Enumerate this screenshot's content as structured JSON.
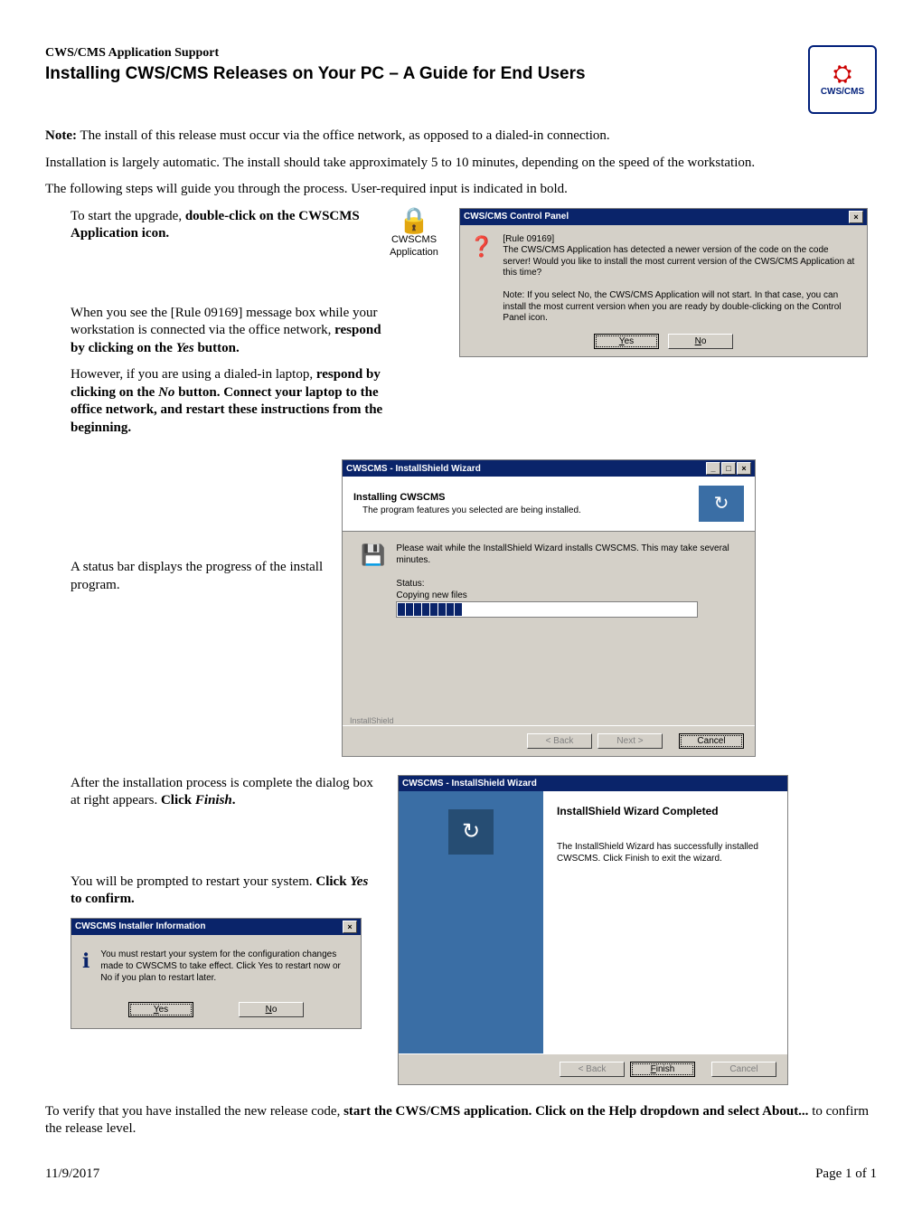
{
  "header": {
    "sup": "CWS/CMS Application Support",
    "title": "Installing CWS/CMS Releases on Your PC – A Guide for End Users",
    "logo_text": "CWS/CMS"
  },
  "intro": {
    "note_label": "Note:",
    "note_text": "  The install of this release must occur via the office network, as opposed to a dialed-in connection.",
    "p2": "Installation is largely automatic.  The install should take approximately 5 to 10 minutes, depending on the speed of the workstation.",
    "p3": "The following steps will guide you through the process.  User-required input is indicated in bold."
  },
  "step1": {
    "a": "To start the upgrade, ",
    "b": "double-click on the CWSCMS Application icon.",
    "icon_label": "CWSCMS Application"
  },
  "step2": {
    "a": "When you see the [Rule 09169] message box while your workstation is connected via the office network, ",
    "b": "respond by clicking on the ",
    "c": "Yes",
    "d": " button."
  },
  "step3": {
    "a": "However, if you are using a dialed-in laptop, ",
    "b": "respond by clicking on the ",
    "c": "No",
    "d": " button.  Connect your laptop to the office network, and restart these instructions from the beginning."
  },
  "cp": {
    "title": "CWS/CMS Control Panel",
    "rule": "[Rule 09169]",
    "msg": "The CWS/CMS Application has detected a newer version of the code on the code server!  Would you like to install the most current version of the CWS/CMS Application at this time?",
    "note": "Note: If you select No, the CWS/CMS Application will not start. In that case, you can install the most current version when you are ready by double-clicking on the Control Panel icon.",
    "yes": "Yes",
    "no": "No"
  },
  "step4": {
    "text": "A status bar displays the progress of the install program."
  },
  "is": {
    "title": "CWSCMS - InstallShield Wizard",
    "h1": "Installing CWSCMS",
    "h2": "The program features you selected are being installed.",
    "body": "Please wait while the InstallShield Wizard installs CWSCMS. This may take several minutes.",
    "status_label": "Status:",
    "status_value": "Copying new files",
    "footline": "InstallShield",
    "back": "< Back",
    "next": "Next >",
    "cancel": "Cancel"
  },
  "step5": {
    "a": "After the installation process is complete the dialog box at right appears. ",
    "b": "Click ",
    "c": "Finish",
    "d": "."
  },
  "cw": {
    "title": "CWSCMS - InstallShield Wizard",
    "h": "InstallShield Wizard Completed",
    "body": "The InstallShield Wizard has successfully installed CWSCMS. Click Finish to exit the wizard.",
    "back": "< Back",
    "finish": "Finish",
    "cancel": "Cancel"
  },
  "step6": {
    "a": "You will be prompted to restart your system.  ",
    "b": "Click ",
    "c": "Yes",
    "d": " to confirm."
  },
  "ii": {
    "title": "CWSCMS Installer Information",
    "body": "You must restart your system for the configuration changes made to CWSCMS to take effect. Click Yes to restart now or No if you plan to restart later.",
    "yes": "Yes",
    "no": "No"
  },
  "verify": {
    "a": "To verify that you have installed the new release code, ",
    "b": "start the CWS/CMS application.  Click on the Help dropdown and select About...",
    "c": " to confirm the release level."
  },
  "footer": {
    "date": "11/9/2017",
    "page": "Page 1 of 1"
  }
}
